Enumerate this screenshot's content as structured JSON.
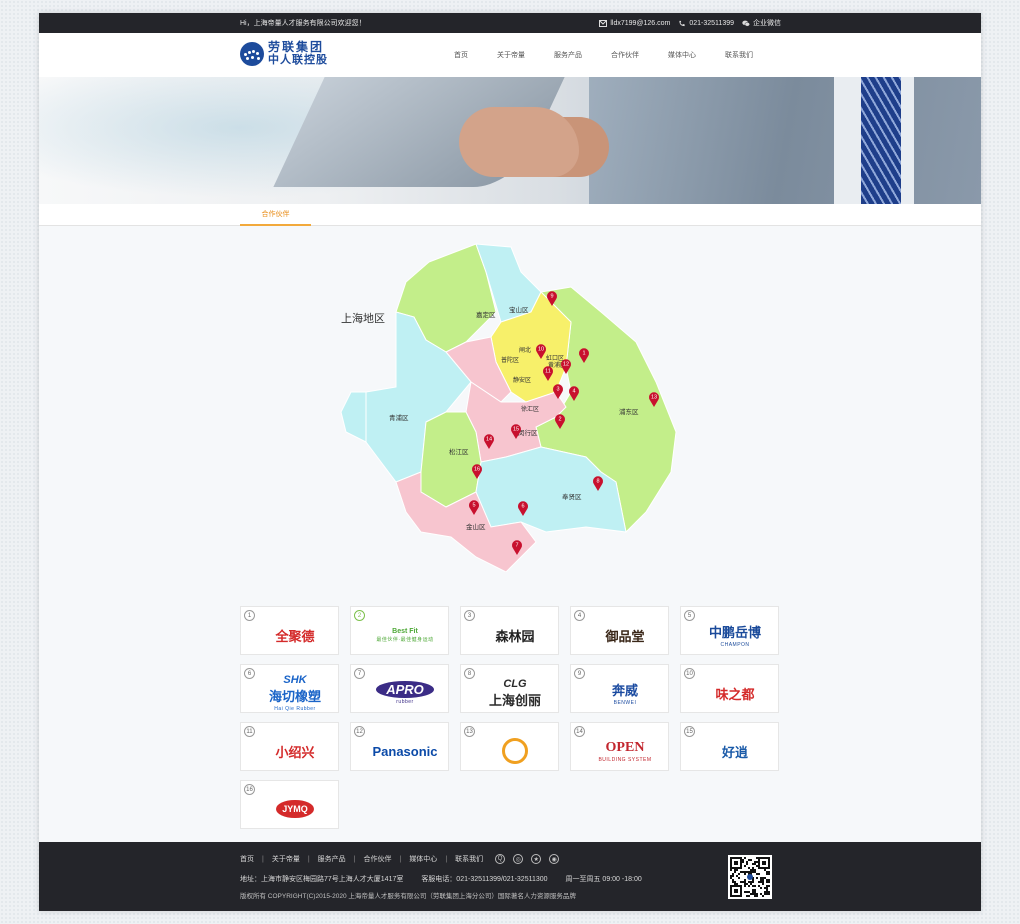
{
  "topbar": {
    "welcome": "Hi，上海帝量人才服务有限公司欢迎您！",
    "email": "lldx7199@126.com",
    "phone": "021-32511399",
    "wechat": "企业微信"
  },
  "logo": {
    "line1": "劳联集团",
    "line2": "中人联控股"
  },
  "nav": [
    "首页",
    "关于帝量",
    "服务产品",
    "合作伙伴",
    "媒体中心",
    "联系我们"
  ],
  "tab": {
    "label": "合作伙伴"
  },
  "map": {
    "title": "上海地区",
    "districts": [
      {
        "name": "嘉定区"
      },
      {
        "name": "宝山区"
      },
      {
        "name": "闸北"
      },
      {
        "name": "普陀区"
      },
      {
        "name": "虹口区"
      },
      {
        "name": "黄浦区"
      },
      {
        "name": "静安区"
      },
      {
        "name": "徐汇区"
      },
      {
        "name": "浦东区"
      },
      {
        "name": "青浦区"
      },
      {
        "name": "闵行区"
      },
      {
        "name": "松江区"
      },
      {
        "name": "奉贤区"
      },
      {
        "name": "金山区"
      }
    ],
    "pins": [
      "1",
      "2",
      "3",
      "4",
      "5",
      "6",
      "7",
      "8",
      "9",
      "10",
      "11",
      "12",
      "13",
      "14",
      "15",
      "16"
    ]
  },
  "partners": [
    {
      "num": "1",
      "name": "全聚德",
      "color": "#d42a2a"
    },
    {
      "num": "2",
      "name": "Best Fit",
      "sub": "最佳伙伴·最佳健身运动",
      "color": "#4da836"
    },
    {
      "num": "3",
      "name": "森林园",
      "color": "#222"
    },
    {
      "num": "4",
      "name": "御品堂",
      "color": "#3a2718"
    },
    {
      "num": "5",
      "name": "中鹏岳博",
      "sub": "CHAMPON",
      "color": "#1a4a9a"
    },
    {
      "num": "6",
      "name": "海切橡塑",
      "mark": "SHK",
      "sub": "Hai Qie Rubber",
      "color": "#1a64c8"
    },
    {
      "num": "7",
      "name": "APRO",
      "sub": "rubber",
      "color": "#3b2c86"
    },
    {
      "num": "8",
      "name": "上海创丽",
      "mark": "CLG",
      "color": "#2a2a2a"
    },
    {
      "num": "9",
      "name": "奔威",
      "sub": "BENWEI",
      "color": "#1a4aa0"
    },
    {
      "num": "10",
      "name": "味之都",
      "color": "#d42a2a"
    },
    {
      "num": "11",
      "name": "小绍兴",
      "color": "#d42a2a"
    },
    {
      "num": "12",
      "name": "Panasonic",
      "color": "#0b4aa8"
    },
    {
      "num": "13",
      "name": "",
      "color": "#f0a020"
    },
    {
      "num": "14",
      "name": "OPEN",
      "sub": "BUILDING SYSTEM",
      "color": "#c2262e"
    },
    {
      "num": "15",
      "name": "好逍",
      "color": "#1a5aa8"
    },
    {
      "num": "16",
      "name": "JYMQ",
      "color": "#d42a2a"
    }
  ],
  "footer": {
    "nav": [
      "首页",
      "关于帝量",
      "服务产品",
      "合作伙伴",
      "媒体中心",
      "联系我们"
    ],
    "address": "地址：上海市静安区梅园路77号上海人才大厦1417室",
    "hotline": "客服电话：021-32511399/021-32511300",
    "hours": "周一至周五  09:00 -18:00",
    "copyright": "版权所有 COPYRIGHT(C)2015-2020  上海帝量人才服务有限公司（劳联集团上海分公司）国际著名人力资源服务品牌"
  },
  "colors": {
    "accent": "#f2a93b",
    "dark": "#24252a",
    "pin": "#c8102e"
  }
}
